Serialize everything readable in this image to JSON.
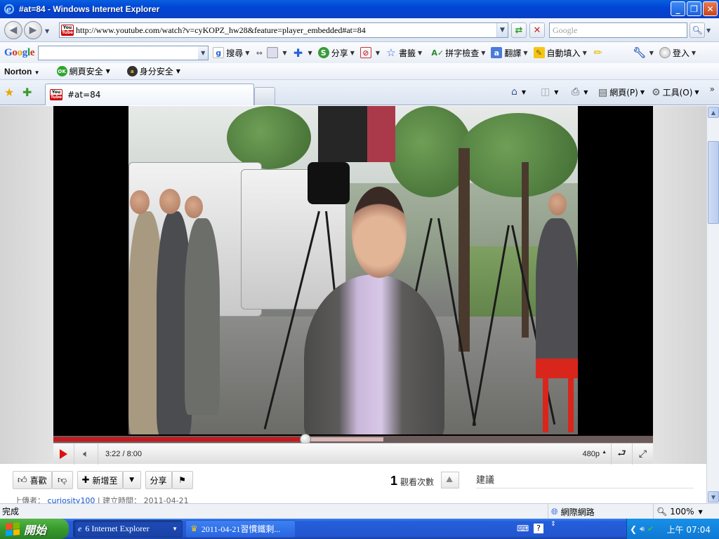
{
  "window": {
    "title": "#at=84 - Windows Internet Explorer",
    "buttons": [
      "_",
      "❐",
      "✕"
    ]
  },
  "address_bar": {
    "url": "http://www.youtube.com/watch?v=cyKOPZ_hw28&feature=player_embedded#at=84",
    "search_placeholder": "Google"
  },
  "google_toolbar": {
    "logo_letters": [
      "G",
      "o",
      "o",
      "g",
      "l",
      "e"
    ],
    "items": [
      {
        "label": "搜尋",
        "icon": "google-search-icon"
      },
      {
        "label": "分享",
        "icon": "share-icon"
      },
      {
        "label": "書籤",
        "icon": "bookmark-star-icon"
      },
      {
        "label": "拼字檢查",
        "icon": "spellcheck-icon"
      },
      {
        "label": "翻譯",
        "icon": "translate-icon"
      },
      {
        "label": "自動填入",
        "icon": "autofill-icon"
      },
      {
        "label": "登入",
        "icon": "user-icon"
      }
    ]
  },
  "norton_toolbar": {
    "brand": "Norton",
    "items": [
      {
        "label": "網頁安全",
        "badge": "OK"
      },
      {
        "label": "身分安全",
        "badge": "a"
      }
    ]
  },
  "tabs": {
    "active_tab": "#at=84",
    "commands": [
      {
        "label": "網頁(P)"
      },
      {
        "label": "工具(O)"
      }
    ],
    "chevron": "»"
  },
  "player": {
    "time": "3:22 / 8:00",
    "progress_fraction": 0.42,
    "buffered_fraction": 0.55,
    "quality": "480p"
  },
  "actions": {
    "like": "喜歡",
    "add_to": "新增至",
    "share": "分享",
    "view_count": "1",
    "views_label": "觀看次數",
    "suggestions": "建議",
    "uploader_label": "上傳者：",
    "uploader": "curiosity100",
    "date_label": "建立時間：",
    "date": "2011-04-21"
  },
  "statusbar": {
    "status": "完成",
    "zone": "網際網路",
    "zoom": "100%"
  },
  "taskbar": {
    "start": "開始",
    "tasks": [
      "6 Internet Explorer",
      "2011-04-21習慣鐵剩..."
    ],
    "clock": "上午 07:04"
  }
}
